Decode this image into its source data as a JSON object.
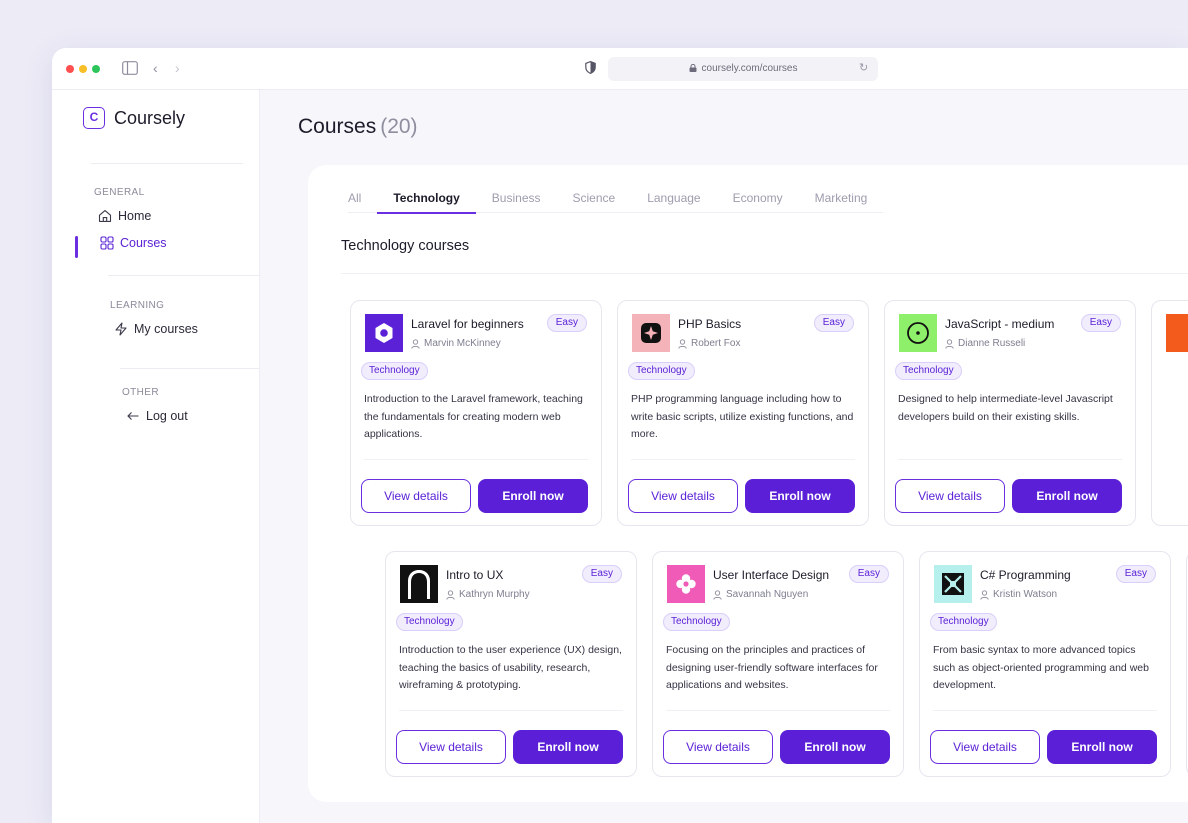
{
  "browser": {
    "url": "coursely.com/courses"
  },
  "app": {
    "name": "Coursely",
    "logo_letter": "C"
  },
  "sidebar": {
    "sections": [
      {
        "label": "GENERAL",
        "items": [
          {
            "label": "Home",
            "icon": "home-icon"
          },
          {
            "label": "Courses",
            "icon": "grid-icon",
            "active": true
          }
        ]
      },
      {
        "label": "LEARNING",
        "items": [
          {
            "label": "My courses",
            "icon": "lightning-icon"
          }
        ]
      },
      {
        "label": "OTHER",
        "items": [
          {
            "label": "Log out",
            "icon": "arrow-left-icon"
          }
        ]
      }
    ]
  },
  "page": {
    "title": "Courses",
    "count": "(20)"
  },
  "tabs": [
    {
      "label": "All"
    },
    {
      "label": "Technology",
      "active": true
    },
    {
      "label": "Business"
    },
    {
      "label": "Science"
    },
    {
      "label": "Language"
    },
    {
      "label": "Economy"
    },
    {
      "label": "Marketing"
    }
  ],
  "section_title": "Technology courses",
  "buttons": {
    "view": "View details",
    "enroll": "Enroll now"
  },
  "courses": [
    {
      "title": "Laravel for beginners",
      "author": "Marvin McKinney",
      "level": "Easy",
      "tag": "Technology",
      "description": "Introduction to the Laravel framework, teaching the fundamentals for creating modern web applications.",
      "thumb_color": "#5b21d6"
    },
    {
      "title": "PHP Basics",
      "author": "Robert Fox",
      "level": "Easy",
      "tag": "Technology",
      "description": "PHP programming language including how to write basic scripts, utilize existing functions, and more.",
      "thumb_color": "#f4b3b8"
    },
    {
      "title": "JavaScript - medium",
      "author": "Dianne Russeli",
      "level": "Easy",
      "tag": "Technology",
      "description": "Designed to help intermediate-level Javascript developers build on their existing skills.",
      "thumb_color": "#8ef06a"
    },
    {
      "title": "Intro to UX",
      "author": "Kathryn Murphy",
      "level": "Easy",
      "tag": "Technology",
      "description": "Introduction to the user experience (UX) design, teaching the basics of usability, research, wireframing & prototyping.",
      "thumb_color": "#ffffff"
    },
    {
      "title": "User Interface Design",
      "author": "Savannah Nguyen",
      "level": "Easy",
      "tag": "Technology",
      "description": "Focusing on the principles and practices of designing user-friendly software interfaces for applications and websites.",
      "thumb_color": "#f05bb8"
    },
    {
      "title": "C# Programming",
      "author": "Kristin Watson",
      "level": "Easy",
      "tag": "Technology",
      "description": "From basic syntax to more advanced topics such as object-oriented programming and web development.",
      "thumb_color": "#b6f0ec"
    }
  ],
  "colors": {
    "accent": "#5a1fd6",
    "peek_thumb": "#f25b1c"
  }
}
